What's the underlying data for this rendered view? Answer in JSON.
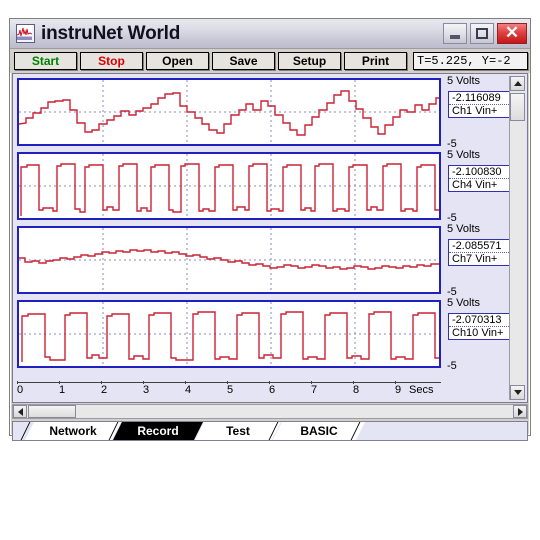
{
  "window": {
    "title": "instruNet World",
    "icon": "waveform-icon",
    "minimize_label": "Minimize",
    "maximize_label": "Maximize",
    "close_label": "Close"
  },
  "toolbar": {
    "buttons": [
      {
        "label": "Start",
        "color": "#008000"
      },
      {
        "label": "Stop",
        "color": "#e00000"
      },
      {
        "label": "Open",
        "color": "#000000"
      },
      {
        "label": "Save",
        "color": "#000000"
      },
      {
        "label": "Setup",
        "color": "#000000"
      },
      {
        "label": "Print",
        "color": "#000000"
      }
    ],
    "readout": "T=5.225,  Y=-2"
  },
  "plot": {
    "y_top_label": "5 Volts",
    "y_bottom_label": "-5",
    "x_unit_label": "Secs",
    "x_ticks": [
      "0",
      "1",
      "2",
      "3",
      "4",
      "5",
      "6",
      "7",
      "8",
      "9"
    ],
    "trace_color": "#cc2233",
    "frame_color": "#2020c0",
    "channels": [
      {
        "name": "Ch1 Vin+",
        "value": "-2.116089"
      },
      {
        "name": "Ch4 Vin+",
        "value": "-2.100830"
      },
      {
        "name": "Ch7 Vin+",
        "value": "-2.085571"
      },
      {
        "name": "Ch10 Vin+",
        "value": "-2.070313"
      }
    ]
  },
  "chart_data": [
    {
      "type": "line",
      "title": "Ch1 Vin+",
      "xlabel": "Secs",
      "ylabel": "Volts",
      "xlim": [
        0,
        9.8
      ],
      "ylim": [
        -5,
        5
      ],
      "grid": true,
      "legend": false,
      "series": [
        {
          "name": "Ch1 Vin+",
          "x": [
            0.0,
            0.18,
            0.36,
            0.55,
            0.73,
            0.91,
            1.09,
            1.27,
            1.45,
            1.64,
            1.82,
            2.0,
            2.18,
            2.36,
            2.55,
            2.73,
            2.91,
            3.09,
            3.27,
            3.45,
            3.64,
            3.82,
            4.0,
            4.18,
            4.36,
            4.55,
            4.73,
            4.91,
            5.09,
            5.27,
            5.45,
            5.64,
            5.82,
            6.0,
            6.18,
            6.36,
            6.55,
            6.73,
            6.91,
            7.09,
            7.27,
            7.45,
            7.64,
            7.82,
            8.0,
            8.18,
            8.36,
            8.55,
            8.73,
            8.91,
            9.09,
            9.27,
            9.45,
            9.64
          ],
          "y": [
            -1.5,
            -0.6,
            0.4,
            1.3,
            1.4,
            0.3,
            -1.4,
            -2.4,
            -1.9,
            -1.3,
            -0.7,
            -0.1,
            0.3,
            -0.4,
            0.1,
            0.5,
            0.9,
            1.8,
            2.2,
            1.1,
            0.1,
            -0.6,
            -1.3,
            -2.0,
            -2.4,
            -1.3,
            -0.3,
            0.2,
            1.0,
            0.3,
            1.2,
            0.4,
            -0.6,
            -1.4,
            -2.2,
            -1.3,
            -0.4,
            0.5,
            1.2,
            1.9,
            2.3,
            1.3,
            0.3,
            -0.6,
            -1.5,
            -2.3,
            -1.4,
            -0.5,
            0.4,
            0.1,
            0.9,
            0.2,
            0.8,
            1.3
          ]
        }
      ]
    },
    {
      "type": "line",
      "title": "Ch4 Vin+",
      "xlabel": "Secs",
      "ylabel": "Volts",
      "xlim": [
        0,
        9.8
      ],
      "ylim": [
        -5,
        5
      ],
      "grid": true,
      "legend": false,
      "note": "square wave, period approx 1.0 s, amplitude approx +/-3 V",
      "series": [
        {
          "name": "Ch4 Vin+",
          "period": 1.0,
          "high": 3.0,
          "low": -3.0,
          "duty": 0.5
        }
      ]
    },
    {
      "type": "line",
      "title": "Ch7 Vin+",
      "xlabel": "Secs",
      "ylabel": "Volts",
      "xlim": [
        0,
        9.8
      ],
      "ylim": [
        -5,
        5
      ],
      "grid": true,
      "legend": false,
      "series": [
        {
          "name": "Ch7 Vin+",
          "x": [
            0.0,
            0.3,
            0.6,
            0.9,
            1.2,
            1.5,
            1.8,
            2.1,
            2.4,
            2.7,
            3.0,
            3.3,
            3.6,
            3.9,
            4.2,
            4.5,
            4.8,
            5.1,
            5.4,
            5.7,
            6.0,
            6.3,
            6.6,
            6.9,
            7.2,
            7.5,
            7.8,
            8.1,
            8.4,
            8.7,
            9.0,
            9.3,
            9.6
          ],
          "y": [
            0.1,
            -0.2,
            -0.1,
            0.1,
            0.4,
            0.7,
            0.9,
            1.0,
            1.0,
            0.9,
            0.7,
            0.5,
            0.4,
            0.2,
            0.1,
            0.0,
            -0.1,
            -0.2,
            -0.4,
            -0.7,
            -0.9,
            -0.8,
            -0.6,
            -0.8,
            -0.9,
            -0.7,
            -0.5,
            -0.7,
            -0.9,
            -0.8,
            -0.6,
            -0.7,
            -0.5
          ]
        }
      ]
    },
    {
      "type": "line",
      "title": "Ch10 Vin+",
      "xlabel": "Secs",
      "ylabel": "Volts",
      "xlim": [
        0,
        9.8
      ],
      "ylim": [
        -5,
        5
      ],
      "grid": true,
      "legend": false,
      "note": "square wave, period approx 1.3 s, amplitude approx +/-3 V",
      "series": [
        {
          "name": "Ch10 Vin+",
          "period": 1.3,
          "high": 3.0,
          "low": -3.0,
          "duty": 0.5
        }
      ]
    }
  ],
  "tabs": [
    {
      "label": "Network",
      "active": false
    },
    {
      "label": "Record",
      "active": true
    },
    {
      "label": "Test",
      "active": false
    },
    {
      "label": "BASIC",
      "active": false
    }
  ]
}
